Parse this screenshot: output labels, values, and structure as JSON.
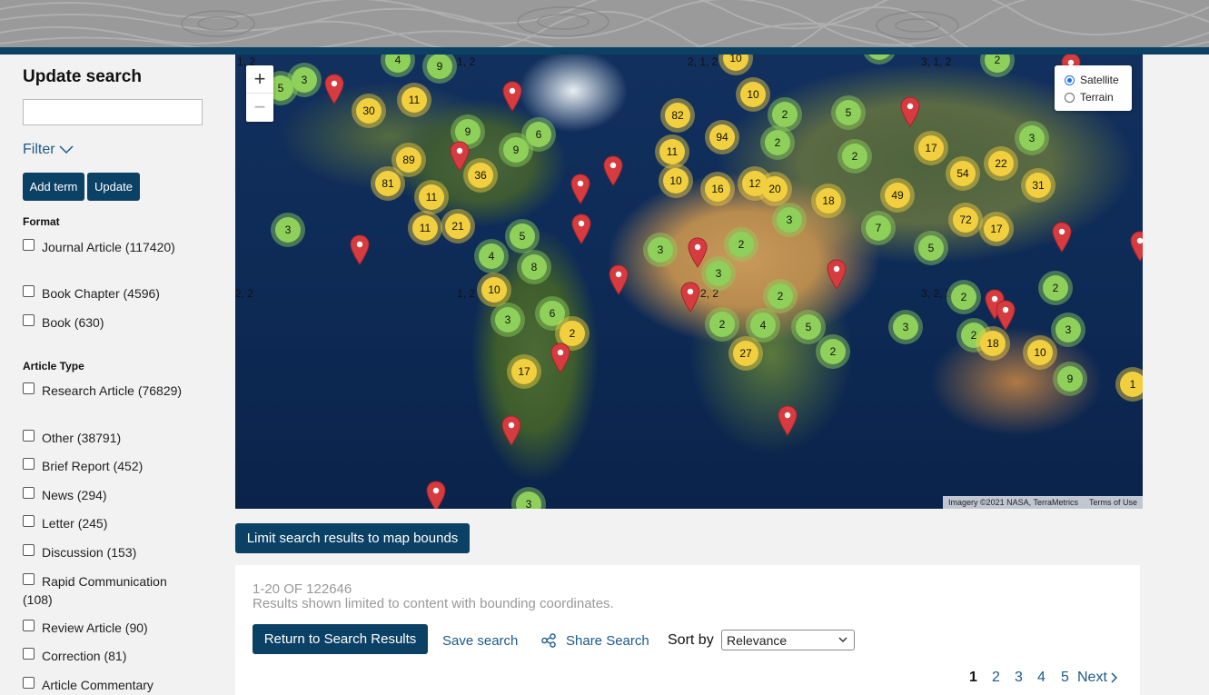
{
  "sidebar": {
    "title": "Update search",
    "search_value": "",
    "filter_label": "Filter",
    "add_term_label": "Add term",
    "update_label": "Update",
    "format": {
      "heading": "Format",
      "items": [
        {
          "label": "Journal Article (117420)",
          "checked": false
        },
        {
          "label": "Book Chapter (4596)",
          "checked": false
        },
        {
          "label": "Book (630)",
          "checked": false
        }
      ]
    },
    "article_type": {
      "heading": "Article Type",
      "items": [
        {
          "label": "Research Article (76829)",
          "checked": false
        },
        {
          "label": "Other (38791)",
          "checked": false
        },
        {
          "label": "Brief Report (452)",
          "checked": false
        },
        {
          "label": "News (294)",
          "checked": false
        },
        {
          "label": "Letter (245)",
          "checked": false
        },
        {
          "label": "Discussion (153)",
          "checked": false
        },
        {
          "label": "Rapid Communication (108)",
          "checked": false
        },
        {
          "label": "Review Article (90)",
          "checked": false
        },
        {
          "label": "Correction (81)",
          "checked": false
        },
        {
          "label": "Article Commentary",
          "checked": false
        }
      ]
    }
  },
  "map": {
    "zoom_in": "+",
    "zoom_out": "−",
    "layers": {
      "satellite": "Satellite",
      "terrain": "Terrain",
      "selected": "Satellite"
    },
    "attribution": "Imagery ©2021 NASA, TerraMetrics",
    "terms": "Terms of Use",
    "wrap_labels": [
      "1, 2",
      "1, 2",
      "2, 1, 2",
      "3, 1, 2",
      "2, 2",
      "1, 2",
      "2, 2",
      "3, 2, 2"
    ],
    "clusters": [
      [
        "5",
        "g"
      ],
      [
        "3",
        "g"
      ],
      [
        "4",
        "g"
      ],
      [
        "9",
        "g"
      ],
      [
        "10",
        "y"
      ],
      [
        "2",
        "g"
      ],
      [
        "2",
        "g"
      ],
      [
        "5",
        "g"
      ],
      [
        "30",
        "y"
      ],
      [
        "11",
        "y"
      ],
      [
        "82",
        "y"
      ],
      [
        "10",
        "y"
      ],
      [
        "2",
        "g"
      ],
      [
        "5",
        "g"
      ],
      [
        "9",
        "g"
      ],
      [
        "6",
        "g"
      ],
      [
        "9",
        "g"
      ],
      [
        "94",
        "y"
      ],
      [
        "2",
        "g"
      ],
      [
        "3",
        "g"
      ],
      [
        "89",
        "y"
      ],
      [
        "36",
        "y"
      ],
      [
        "11",
        "y"
      ],
      [
        "17",
        "y"
      ],
      [
        "2",
        "g"
      ],
      [
        "54",
        "y"
      ],
      [
        "22",
        "y"
      ],
      [
        "81",
        "y"
      ],
      [
        "11",
        "y"
      ],
      [
        "10",
        "y"
      ],
      [
        "16",
        "y"
      ],
      [
        "12",
        "y"
      ],
      [
        "20",
        "y"
      ],
      [
        "18",
        "y"
      ],
      [
        "49",
        "y"
      ],
      [
        "31",
        "y"
      ],
      [
        "3",
        "g"
      ],
      [
        "11",
        "y"
      ],
      [
        "21",
        "y"
      ],
      [
        "5",
        "g"
      ],
      [
        "3",
        "g"
      ],
      [
        "72",
        "y"
      ],
      [
        "17",
        "y"
      ],
      [
        "7",
        "g"
      ],
      [
        "4",
        "g"
      ],
      [
        "3",
        "g"
      ],
      [
        "2",
        "g"
      ],
      [
        "8",
        "g"
      ],
      [
        "3",
        "g"
      ],
      [
        "5",
        "g"
      ],
      [
        "10",
        "y"
      ],
      [
        "2",
        "g"
      ],
      [
        "2",
        "g"
      ],
      [
        "2",
        "g"
      ],
      [
        "3",
        "g"
      ],
      [
        "6",
        "g"
      ],
      [
        "2",
        "y"
      ],
      [
        "2",
        "g"
      ],
      [
        "4",
        "g"
      ],
      [
        "5",
        "g"
      ],
      [
        "3",
        "g"
      ],
      [
        "2",
        "g"
      ],
      [
        "3",
        "g"
      ],
      [
        "18",
        "y"
      ],
      [
        "10",
        "y"
      ],
      [
        "27",
        "y"
      ],
      [
        "2",
        "g"
      ],
      [
        "17",
        "y"
      ],
      [
        "9",
        "g"
      ],
      [
        "1",
        "y"
      ],
      [
        "3",
        "g"
      ]
    ]
  },
  "limit_button": "Limit search results to map bounds",
  "results": {
    "count": "1-20 OF 122646",
    "note": "Results shown limited to content with bounding coordinates.",
    "return_button": "Return to Search Results",
    "save_search": "Save search",
    "share_search": "Share Search",
    "sort_label": "Sort by",
    "sort_value": "Relevance",
    "pages": [
      "1",
      "2",
      "3",
      "4",
      "5"
    ],
    "current_page": "1",
    "next_label": "Next"
  }
}
